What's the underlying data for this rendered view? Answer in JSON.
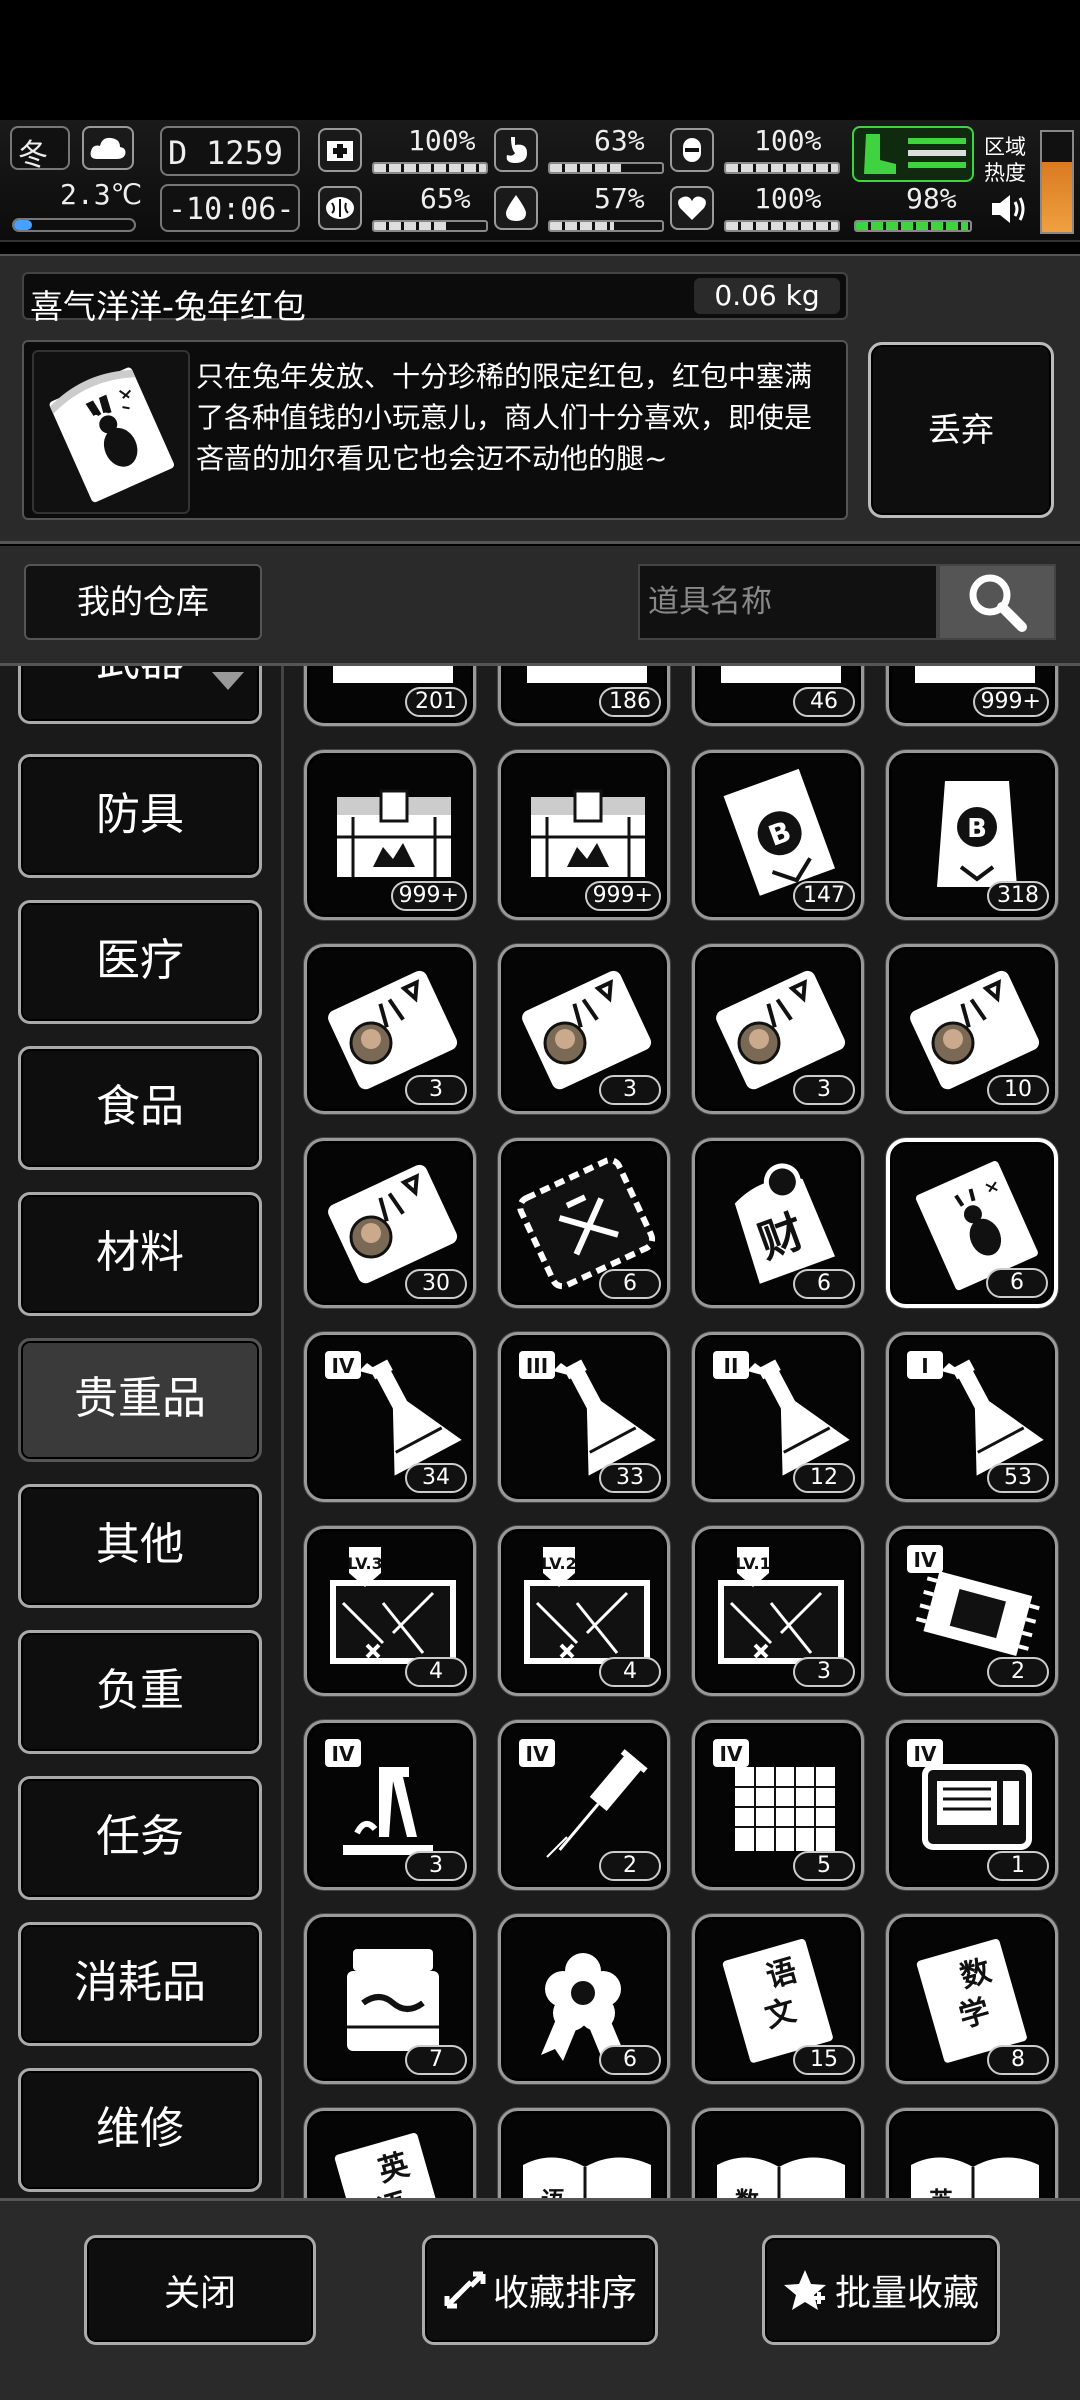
{
  "status": {
    "season": "冬",
    "temperature": "2.3℃",
    "day": "1259",
    "time": "-10:06-",
    "health": "100%",
    "hunger": "63%",
    "armor": "100%",
    "mood": "65%",
    "thirst": "57%",
    "heart": "100%",
    "stamina": "98%",
    "region_label": "区域热度"
  },
  "item": {
    "name": "喜气洋洋-兔年红包",
    "weight": "0.06 kg",
    "description": "只在兔年发放、十分珍稀的限定红包，红包中塞满了各种值钱的小玩意儿，商人们十分喜欢，即使是吝啬的加尔看见它也会迈不动他的腿~",
    "discard_label": "丢弃"
  },
  "warehouse": {
    "title": "我的仓库",
    "search_placeholder": "道具名称"
  },
  "categories": [
    "武器",
    "防具",
    "医疗",
    "食品",
    "材料",
    "贵重品",
    "其他",
    "负重",
    "任务",
    "消耗品",
    "维修"
  ],
  "active_category": "贵重品",
  "items": [
    {
      "icon": "crate-icon",
      "count": "201"
    },
    {
      "icon": "crate-icon",
      "count": "186"
    },
    {
      "icon": "crate-icon",
      "count": "46"
    },
    {
      "icon": "crate-icon",
      "count": "999+"
    },
    {
      "icon": "weapon-crate-icon",
      "count": "999+"
    },
    {
      "icon": "weapon-crate-icon",
      "count": "999+"
    },
    {
      "icon": "bitcoin-scroll-icon",
      "count": "147"
    },
    {
      "icon": "bitcoin-bag-icon",
      "count": "318"
    },
    {
      "icon": "portrait-ticket-icon",
      "count": "3"
    },
    {
      "icon": "portrait-ticket-icon",
      "count": "3"
    },
    {
      "icon": "portrait-ticket-icon",
      "count": "3"
    },
    {
      "icon": "portrait-ticket-icon",
      "count": "10"
    },
    {
      "icon": "portrait-ticket-icon",
      "count": "30"
    },
    {
      "icon": "lucky-ticket-icon",
      "count": "6"
    },
    {
      "icon": "fortune-bag-icon",
      "count": "6"
    },
    {
      "icon": "rabbit-red-packet-icon",
      "count": "6"
    },
    {
      "icon": "flask-icon",
      "count": "34"
    },
    {
      "icon": "flask-icon",
      "count": "33"
    },
    {
      "icon": "flask-icon",
      "count": "12"
    },
    {
      "icon": "flask-icon",
      "count": "53"
    },
    {
      "icon": "treasure-map-icon",
      "count": "4"
    },
    {
      "icon": "treasure-map-icon",
      "count": "4"
    },
    {
      "icon": "treasure-map-icon",
      "count": "3"
    },
    {
      "icon": "chip-blueprint-icon",
      "count": "2"
    },
    {
      "icon": "microscope-blueprint-icon",
      "count": "3"
    },
    {
      "icon": "syringe-blueprint-icon",
      "count": "2"
    },
    {
      "icon": "grid-blueprint-icon",
      "count": "5"
    },
    {
      "icon": "machine-blueprint-icon",
      "count": "1"
    },
    {
      "icon": "jar-icon",
      "count": "7"
    },
    {
      "icon": "flower-badge-icon",
      "count": "6"
    },
    {
      "icon": "chinese-book-icon",
      "count": "15"
    },
    {
      "icon": "math-book-icon",
      "count": "8"
    },
    {
      "icon": "english-book-icon",
      "count": ""
    },
    {
      "icon": "chinese-book-open-icon",
      "count": ""
    },
    {
      "icon": "math-book-open-icon",
      "count": ""
    },
    {
      "icon": "english-book-open-icon",
      "count": ""
    }
  ],
  "item_labels": {
    "flask_tiers": [
      "IV",
      "III",
      "II",
      "I"
    ],
    "map_levels": [
      "LV.3",
      "LV.2",
      "LV.1"
    ],
    "blueprint_tier": "IV",
    "book_chinese": "语文",
    "book_math": "数学",
    "book_english": "英语",
    "fortune_char": "财",
    "coin_char": "B"
  },
  "bottom": {
    "close": "关闭",
    "sort_favorites": "收藏排序",
    "batch_favorite": "批量收藏"
  },
  "colors": {
    "stamina_green": "#3fd43f",
    "panel_bg": "#2a2a2a",
    "heat_orange": "#d97a22"
  }
}
